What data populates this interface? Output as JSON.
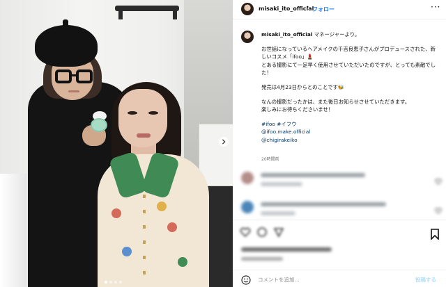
{
  "header": {
    "username": "misaki_ito_official",
    "separator": "•",
    "follow_label": "フォロー",
    "more_label": "···"
  },
  "caption": {
    "username": "misaki_ito_official",
    "intro": "マネージャーより。",
    "paragraph1": "お世話になっているヘアメイクの千吉良恵子さんがプロデュースされた、新しいコスメ「ifoo」💄\nとある撮影にて一足早く使用させていただいたのですが、とっても素敵でした！",
    "paragraph2": "発売は4月23日からとのことです🐝",
    "paragraph3": "なんの撮影だったかは、また後日お知らせさせていただきます。\n楽しみにお待ちくださいませ！",
    "hashtags": "#ifoo #イフウ",
    "mention1": "@ifoo.make.official",
    "mention2": "@chigirakeiko",
    "timestamp": "20時間前"
  },
  "comment_bar": {
    "placeholder": "コメントを追加...",
    "post_label": "投稿する"
  },
  "icons": {
    "follow_color": "#1877f2",
    "link_color": "#00376b",
    "heart_color": "#ed4956"
  }
}
